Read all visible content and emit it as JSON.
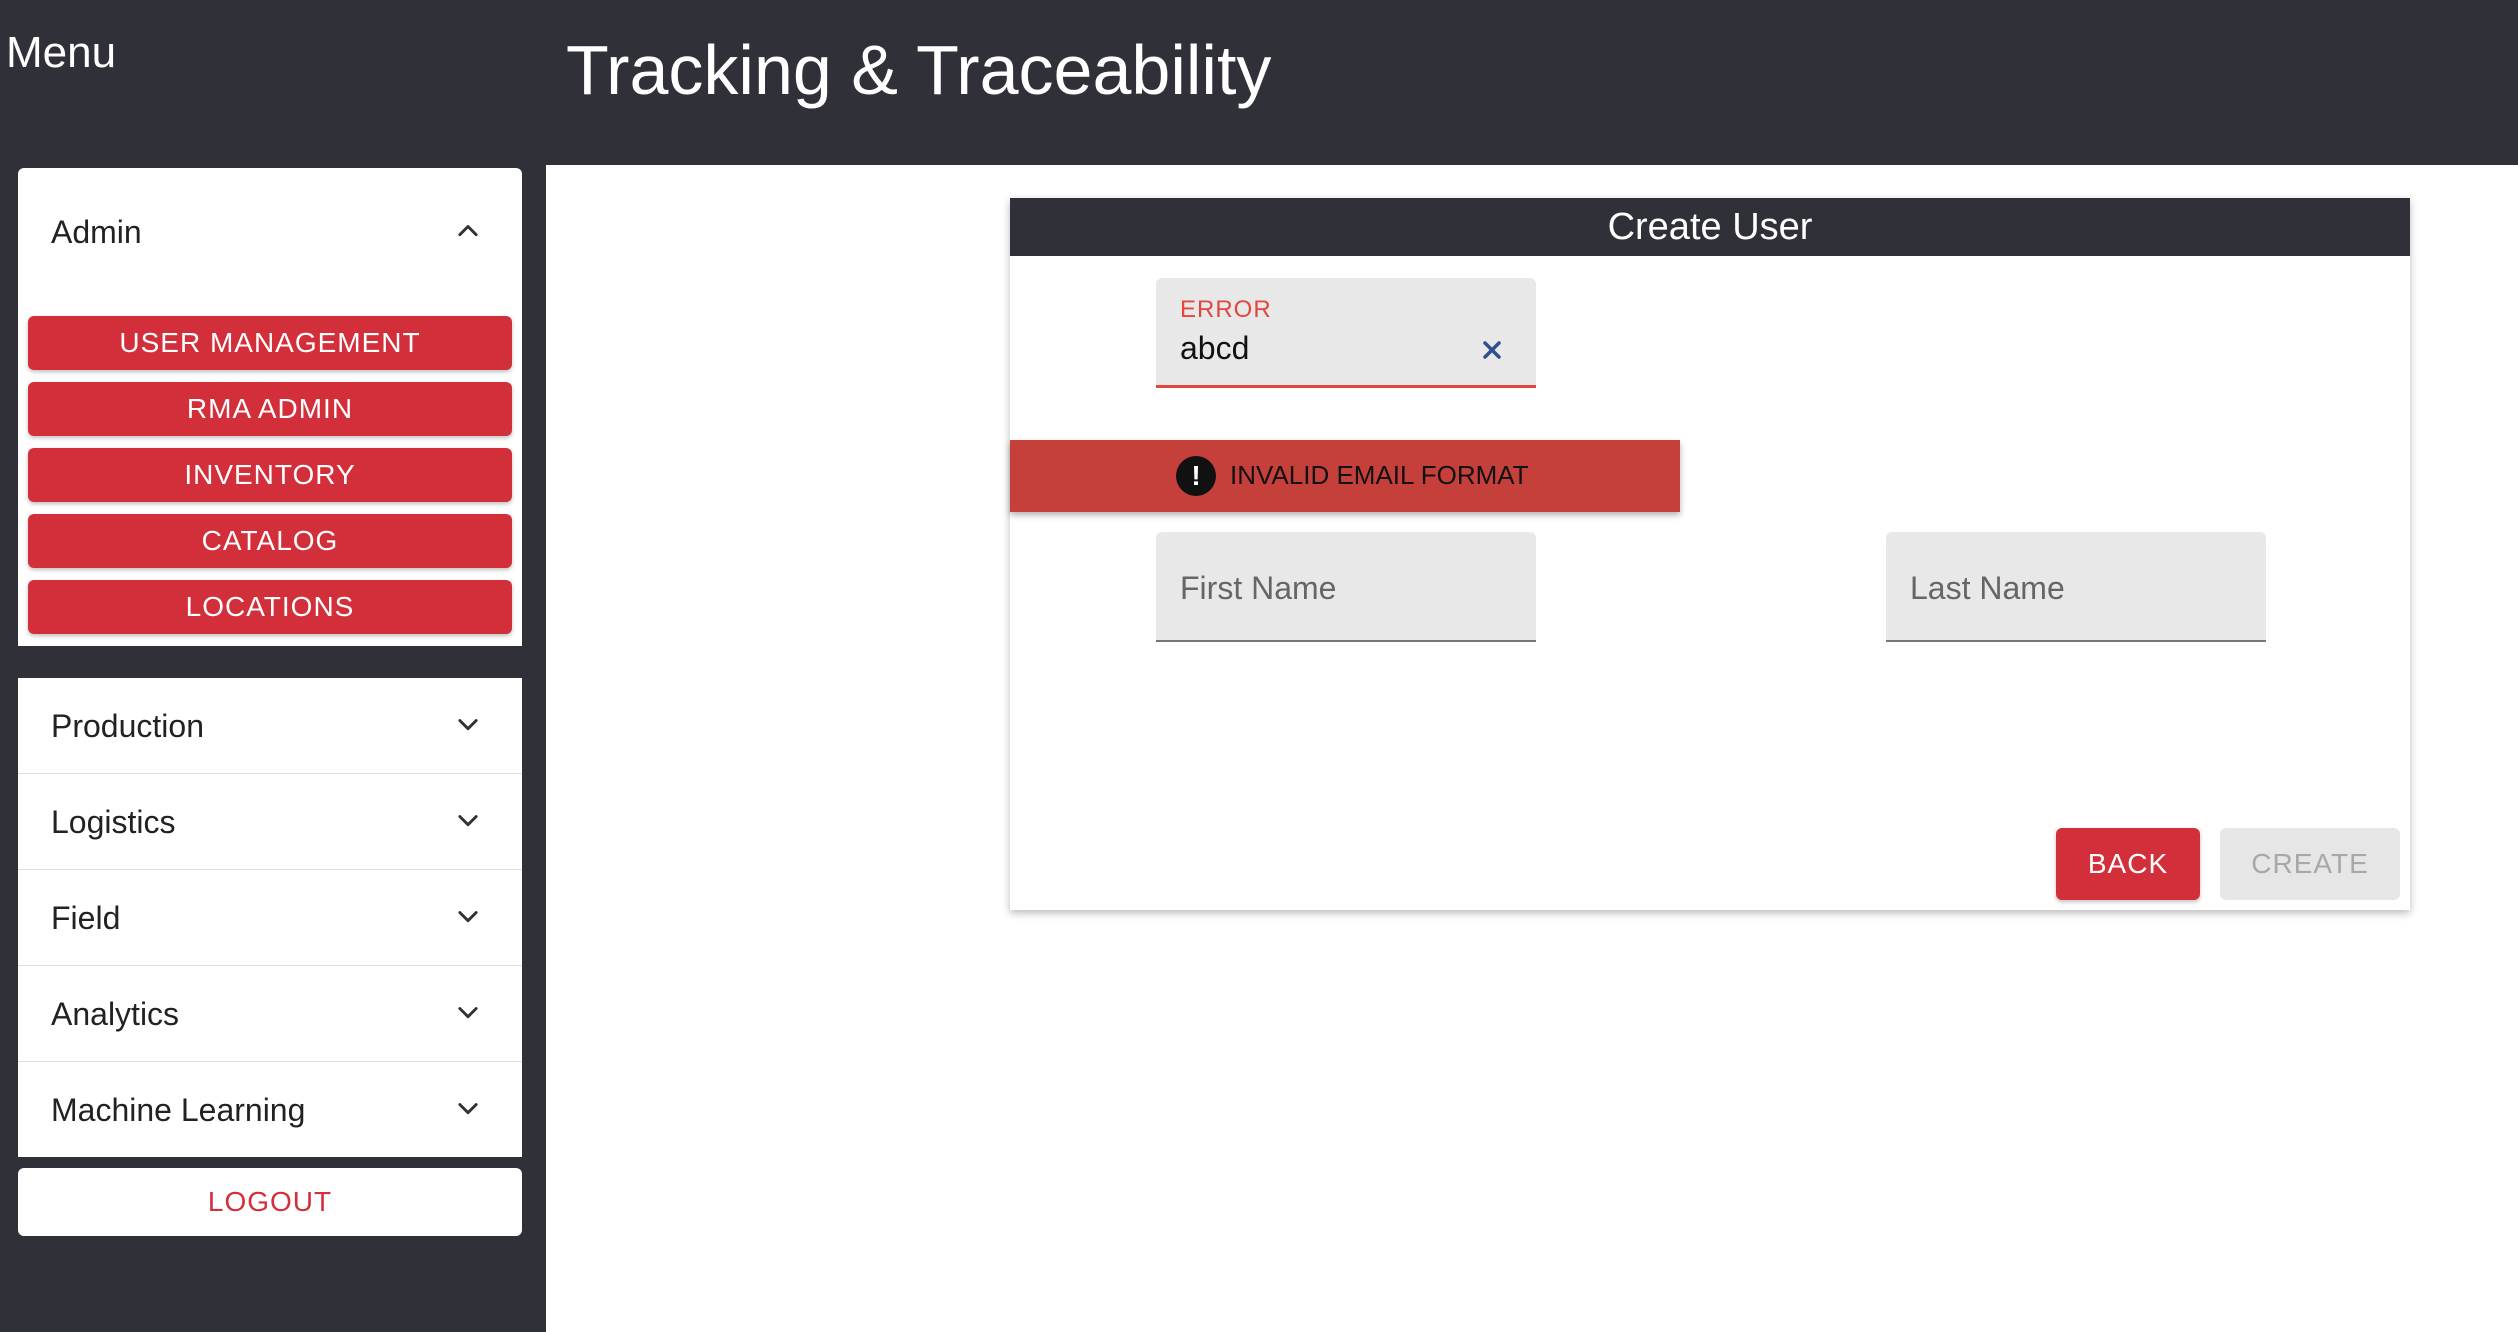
{
  "sidebar": {
    "title": "Menu",
    "admin": {
      "label": "Admin",
      "expanded_icon": "chevron-up-icon",
      "buttons": [
        {
          "label": "USER MANAGEMENT"
        },
        {
          "label": "RMA ADMIN"
        },
        {
          "label": "INVENTORY"
        },
        {
          "label": "CATALOG"
        },
        {
          "label": "LOCATIONS"
        }
      ]
    },
    "sections": [
      {
        "label": "Production",
        "icon": "chevron-down-icon"
      },
      {
        "label": "Logistics",
        "icon": "chevron-down-icon"
      },
      {
        "label": "Field",
        "icon": "chevron-down-icon"
      },
      {
        "label": "Analytics",
        "icon": "chevron-down-icon"
      },
      {
        "label": "Machine Learning",
        "icon": "chevron-down-icon"
      }
    ],
    "logout_label": "LOGOUT"
  },
  "header": {
    "title": "Tracking & Traceability"
  },
  "dialog": {
    "title": "Create User",
    "email": {
      "label": "ERROR",
      "value": "abcd",
      "clear_icon": "close-icon"
    },
    "first_name": {
      "placeholder": "First Name"
    },
    "last_name": {
      "placeholder": "Last Name"
    },
    "back_label": "BACK",
    "create_label": "CREATE"
  },
  "toast": {
    "icon": "exclamation-icon",
    "icon_glyph": "!",
    "message": "INVALID EMAIL FORMAT"
  },
  "colors": {
    "dark": "#303038",
    "accent_red": "#d32f3a",
    "error_red": "#e2463f",
    "toast_red": "#c5403a"
  }
}
